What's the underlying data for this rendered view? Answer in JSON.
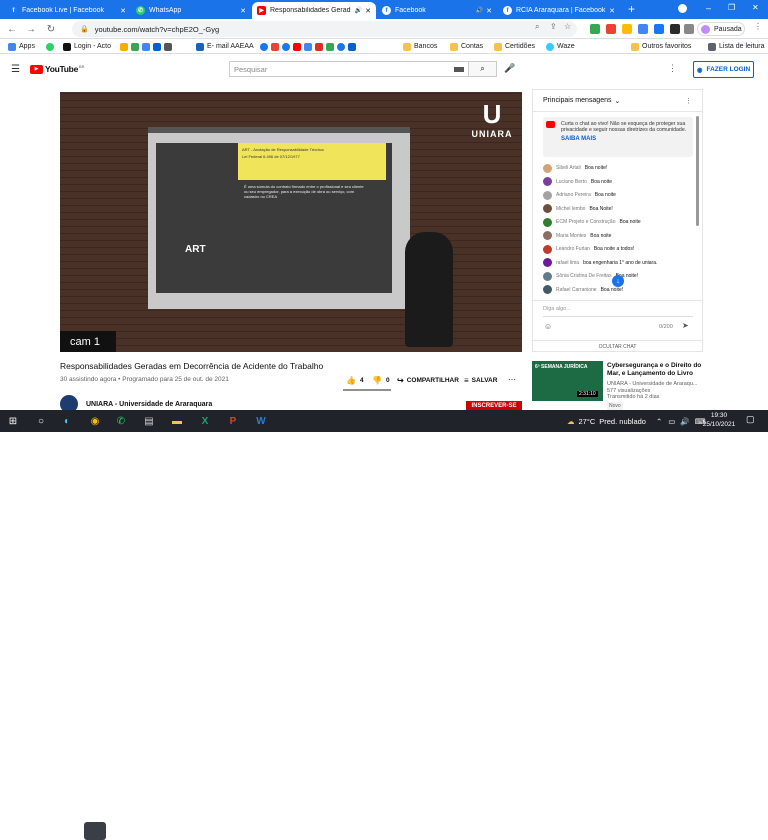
{
  "browser": {
    "tabs": [
      {
        "title": "Facebook Live | Facebook",
        "icon": "facebook-icon",
        "active": false
      },
      {
        "title": "WhatsApp",
        "icon": "whatsapp-icon",
        "active": false
      },
      {
        "title": "Responsabilidades Gerad",
        "icon": "youtube-icon",
        "active": true
      },
      {
        "title": "Facebook",
        "icon": "facebook-icon",
        "active": false
      },
      {
        "title": "RCIA Araraquara | Facebook",
        "icon": "facebook-icon",
        "active": false
      }
    ],
    "new_tab": "+",
    "url": "youtube.com/watch?v=chpE2O_-Gyg",
    "profile_label": "Pausada",
    "bookmarks": [
      {
        "label": "Apps",
        "icon": "apps-icon"
      },
      {
        "label": "",
        "icon": "whatsapp-icon"
      },
      {
        "label": "Login - Acto",
        "icon": "acto-icon"
      },
      {
        "label": "",
        "icon": "bookmark-icon"
      },
      {
        "label": "E- mail AAEAA",
        "icon": "email-icon"
      },
      {
        "label": "Bancos",
        "icon": "folder-icon"
      },
      {
        "label": "Contas",
        "icon": "folder-icon"
      },
      {
        "label": "Certidões",
        "icon": "folder-icon"
      },
      {
        "label": "Waze",
        "icon": "waze-icon"
      },
      {
        "label": "Outros favoritos",
        "icon": "folder-icon"
      },
      {
        "label": "Lista de leitura",
        "icon": "reading-list-icon"
      }
    ]
  },
  "youtube": {
    "logo_text": "YouTube",
    "logo_region": "BR",
    "search_placeholder": "Pesquisar",
    "login_label": "FAZER LOGIN"
  },
  "video": {
    "slide_title": "ART - Anotação de Responsabilidade Técnica",
    "slide_subtitle": "Lei Federal 6.496 de 07/12/1977",
    "slide_body": "É uma súmula do contrato firmado entre o profissional e seu cliente ou seu empregador, para a execução de obra ou serviço, com cadastro no CREA",
    "slide_art_label": "ART",
    "watermark_u": "U",
    "watermark_name": "UNIARA",
    "cam_label": "cam 1",
    "title": "Responsabilidades Geradas em Decorrência de Acidente do Trabalho",
    "meta": "30 assistindo agora • Programado para 25 de out. de 2021",
    "likes": "4",
    "dislikes": "0",
    "share_label": "COMPARTILHAR",
    "save_label": "SALVAR",
    "channel_name": "UNIARA - Universidade de Araraquara",
    "subscribe_label": "INSCREVER-SE"
  },
  "chat": {
    "header": "Principais mensagens",
    "pinned_text": "Curta o chat ao vivo! Não se esqueça de proteger sua privacidade e seguir nossas diretrizes da comunidade.",
    "pinned_link": "SAIBA MAIS",
    "messages": [
      {
        "author": "Sibeli Artali",
        "text": "Boa noite!",
        "color": "#d4a373"
      },
      {
        "author": "Luciano Berto",
        "text": "Boa noite",
        "color": "#7b3fa0"
      },
      {
        "author": "Adriano Pereira",
        "text": "Boa noite",
        "color": "#a3a3a3"
      },
      {
        "author": "Michel lembo",
        "text": "Boa Noite!",
        "color": "#6b4f3a"
      },
      {
        "author": "ECM Projeto e Construção",
        "text": "Boa noite",
        "color": "#2e7d32"
      },
      {
        "author": "Maria Montes",
        "text": "Boa noite",
        "color": "#8d6e63"
      },
      {
        "author": "Leandro Furlan",
        "text": "Boa noite a todos!",
        "color": "#c0392b"
      },
      {
        "author": "rafael lima",
        "text": "boa engenharia 1° ano de uniara.",
        "color": "#6a1b9a"
      },
      {
        "author": "Sônia Cristina De Freitas",
        "text": "Boa noite!",
        "color": "#607d8b"
      },
      {
        "author": "Rafael Carranione",
        "text": "Boa noite!",
        "color": "#455a64"
      }
    ],
    "input_placeholder": "Diga algo...",
    "char_count": "0/200",
    "hide_label": "OCULTAR CHAT"
  },
  "recommended": {
    "thumb_text": "6ª SEMANA JURÍDICA",
    "duration": "2:31:10",
    "title": "Cybersegurança e o Direito do Mar, e Lançamento do Livro",
    "channel": "UNIARA - Universidade de Araraqu...",
    "views": "577 visualizações",
    "time": "Transmitido há 2 dias",
    "badge": "Novo"
  },
  "taskbar": {
    "temperature": "27°C",
    "weather": "Pred. nublado",
    "time": "19:30",
    "date": "25/10/2021"
  }
}
